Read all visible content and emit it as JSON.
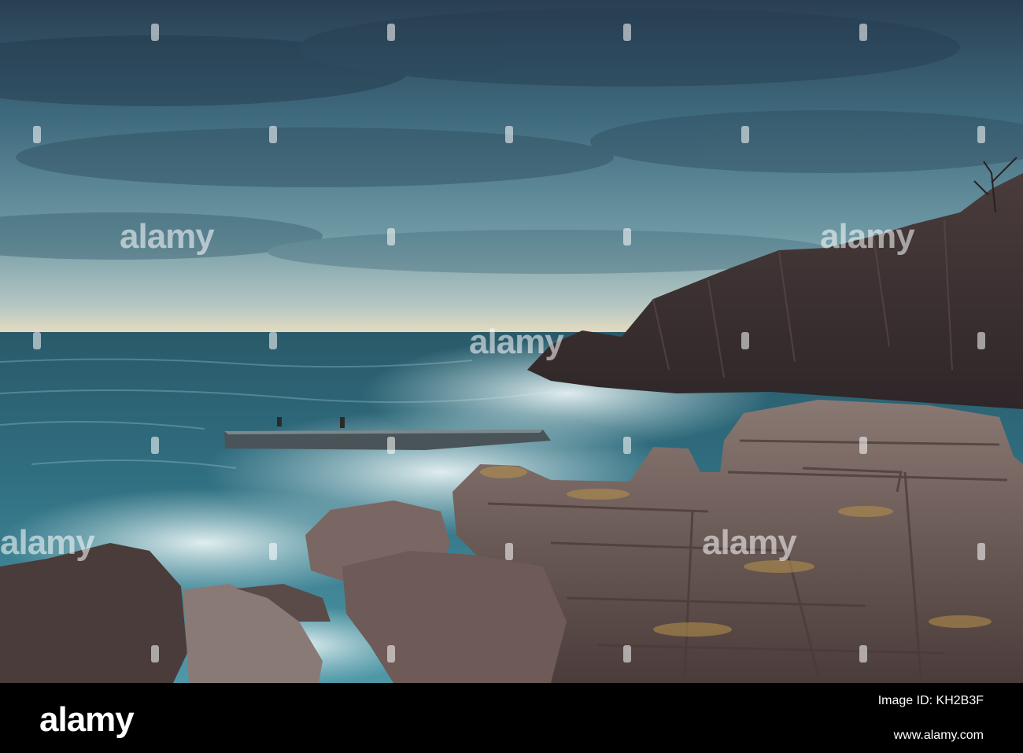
{
  "photo": {
    "subject": "stormy rocky coastline at dusk",
    "colors": {
      "sky_dark": "#2f4a5a",
      "sky_mid": "#5f8a98",
      "horizon_glow": "#e8dcc0",
      "sea_deep": "#1e5a6e",
      "sea_mid": "#3f8293",
      "surf": "#dfeef0",
      "rock_dark": "#3a3030",
      "rock_mid": "#6e5e5a",
      "rock_light": "#a89890"
    }
  },
  "watermark": {
    "text": "alamy"
  },
  "footer": {
    "logo": "alamy",
    "image_id": "Image ID: KH2B3F",
    "url": "www.alamy.com"
  }
}
